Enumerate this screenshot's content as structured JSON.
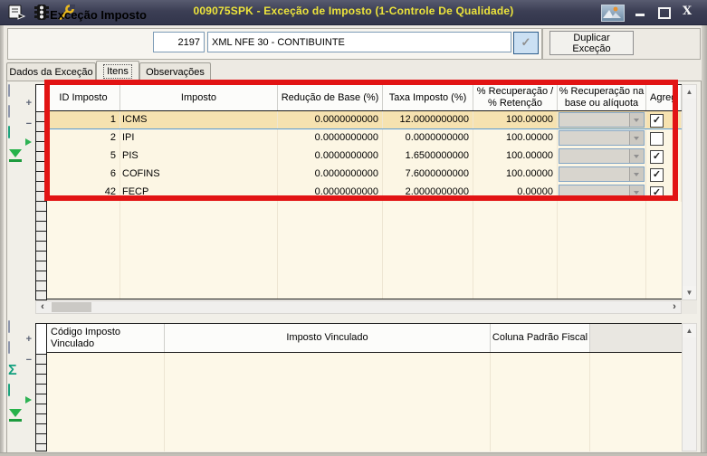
{
  "titlebar": {
    "title": "009075SPK - Exceção de Imposto (1-Controle De Qualidade)",
    "close_glyph": "X"
  },
  "header_panel": {
    "label": "Exceção Imposto",
    "code": "2197",
    "description": "XML NFE 30 - CONTIBUINTE",
    "confirm_glyph": "✓",
    "duplicate_button_label": "Duplicar Exceção"
  },
  "tabs": {
    "items": [
      {
        "label": "Dados da Exceção",
        "active": false
      },
      {
        "label": "Itens",
        "active": true
      },
      {
        "label": "Observações",
        "active": false
      }
    ]
  },
  "items_grid": {
    "columns": [
      "ID Imposto",
      "Imposto",
      "Redução de Base (%)",
      "Taxa Imposto (%)",
      "% Recuperação / % Retenção",
      "% Recuperação na base ou alíquota",
      "Agreg"
    ],
    "rows": [
      {
        "id": "1",
        "imposto": "ICMS",
        "reducao": "0.0000000000",
        "taxa": "12.0000000000",
        "recuperacao": "100.00000",
        "agreg_checked": true,
        "agreg_glyph": "✓",
        "selected": true
      },
      {
        "id": "2",
        "imposto": "IPI",
        "reducao": "0.0000000000",
        "taxa": "0.0000000000",
        "recuperacao": "100.00000",
        "agreg_checked": false,
        "agreg_glyph": "",
        "selected": false
      },
      {
        "id": "5",
        "imposto": "PIS",
        "reducao": "0.0000000000",
        "taxa": "1.6500000000",
        "recuperacao": "100.00000",
        "agreg_checked": true,
        "agreg_glyph": "✓",
        "selected": false
      },
      {
        "id": "6",
        "imposto": "COFINS",
        "reducao": "0.0000000000",
        "taxa": "7.6000000000",
        "recuperacao": "100.00000",
        "agreg_checked": true,
        "agreg_glyph": "✓",
        "selected": false
      },
      {
        "id": "42",
        "imposto": "FECP",
        "reducao": "0.0000000000",
        "taxa": "2.0000000000",
        "recuperacao": "0.00000",
        "agreg_checked": true,
        "agreg_glyph": "✓",
        "selected": false
      }
    ]
  },
  "linked_grid": {
    "columns": [
      "Código Imposto Vinculado",
      "Imposto Vinculado",
      "Coluna Padrão Fiscal"
    ]
  },
  "toolbar_glyphs": {
    "plus": "+",
    "minus": "−",
    "sigma": "Σ"
  },
  "scrollbar_glyphs": {
    "up": "▲",
    "down": "▼",
    "left": "‹",
    "right": "›"
  },
  "colors": {
    "titlebar_bg": "#3C3F55",
    "title_text": "#EDE43B",
    "annotation_red": "#E21414",
    "grid_row_bg": "#FCF6E4",
    "selected_row_bg": "#F6E2B0",
    "selection_line_blue": "#5A9BD5",
    "grid_header_bg": "#FCFCFA",
    "confirm_button_bg": "#CBE0F3"
  }
}
